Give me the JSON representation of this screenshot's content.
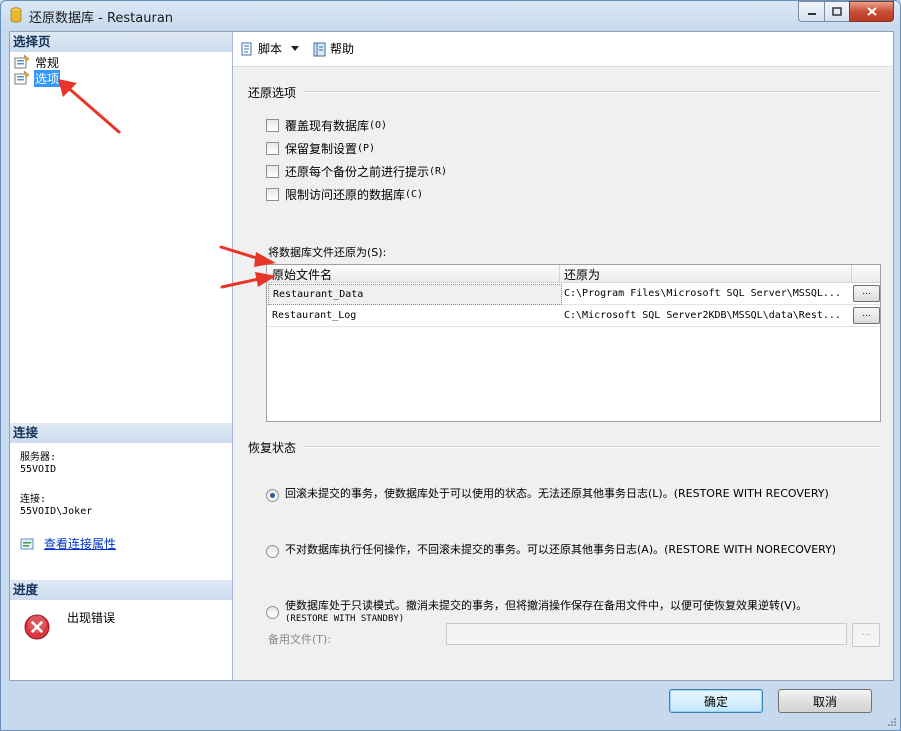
{
  "window": {
    "title": "还原数据库 - Restauran"
  },
  "left": {
    "select_page_header": "选择页",
    "nav_items": [
      {
        "label": "常规",
        "selected": false,
        "icon": "page-icon"
      },
      {
        "label": "选项",
        "selected": true,
        "icon": "page-icon"
      }
    ],
    "connection_header": "连接",
    "server_label": "服务器:",
    "server_value": "55VOID",
    "connection_label": "连接:",
    "connection_value": "55VOID\\Joker",
    "view_props_link": "查看连接属性",
    "progress_header": "进度",
    "progress_status": "出现错误"
  },
  "toolbar": {
    "script_label": "脚本",
    "help_label": "帮助"
  },
  "restore_options": {
    "group_title": "还原选项",
    "checkboxes": [
      {
        "label": "覆盖现有数据库",
        "suffix": "(O)",
        "checked": false
      },
      {
        "label": "保留复制设置",
        "suffix": "(P)",
        "checked": false
      },
      {
        "label": "还原每个备份之前进行提示",
        "suffix": "(R)",
        "checked": false
      },
      {
        "label": "限制访问还原的数据库",
        "suffix": "(C)",
        "checked": false
      }
    ],
    "restore_files_label": "将数据库文件还原为(S):",
    "grid": {
      "columns": [
        "原始文件名",
        "还原为"
      ],
      "rows": [
        {
          "original": "Restaurant_Data",
          "restore_as": "C:\\Program Files\\Microsoft SQL Server\\MSSQL...",
          "button": "..."
        },
        {
          "original": "Restaurant_Log",
          "restore_as": "C:\\Microsoft SQL Server2KDB\\MSSQL\\data\\Rest...",
          "button": "..."
        }
      ]
    }
  },
  "recovery_state": {
    "group_title": "恢复状态",
    "options": [
      {
        "text": "回滚未提交的事务，使数据库处于可以使用的状态。无法还原其他事务日志(L)。(RESTORE WITH RECOVERY)",
        "selected": true
      },
      {
        "text": "不对数据库执行任何操作，不回滚未提交的事务。可以还原其他事务日志(A)。(RESTORE WITH NORECOVERY)",
        "selected": false
      },
      {
        "text": "使数据库处于只读模式。撤消未提交的事务，但将撤消操作保存在备用文件中，以便可使恢复效果逆转(V)。",
        "text2": "(RESTORE WITH STANDBY)",
        "selected": false
      }
    ],
    "standby_label": "备用文件(T):",
    "standby_value": "",
    "standby_button": "..."
  },
  "buttons": {
    "ok": "确定",
    "cancel": "取消"
  },
  "colors": {
    "selection": "#3399ff",
    "link": "#0033cc",
    "annotation_arrow": "#e8352a",
    "error": "#d9363e"
  }
}
